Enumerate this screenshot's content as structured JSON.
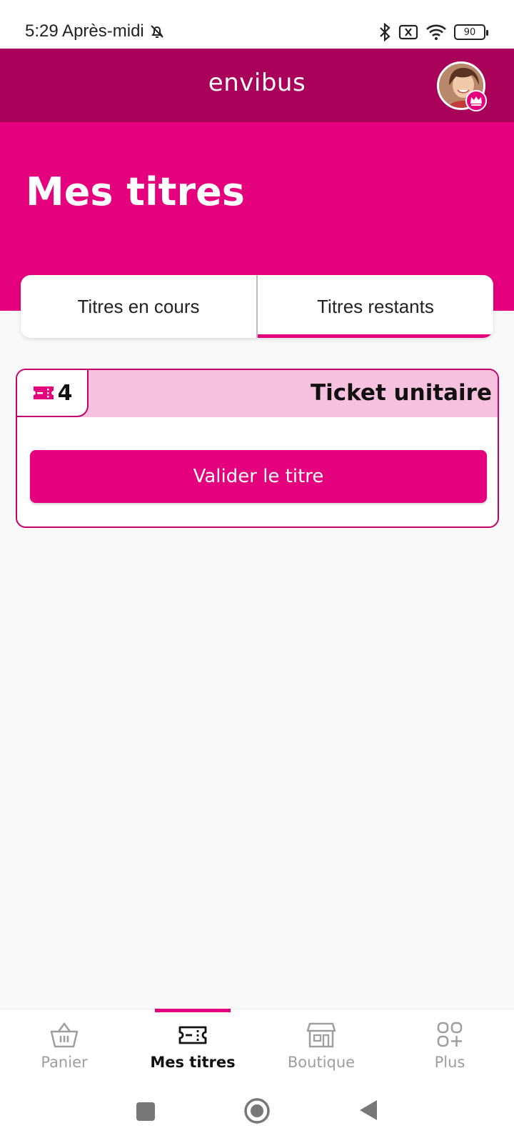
{
  "status_bar": {
    "time": "5:29 Après-midi",
    "battery": "90",
    "icons": [
      "bell-off-icon",
      "bluetooth-icon",
      "sim-off-icon",
      "wifi-icon",
      "battery-icon"
    ]
  },
  "header": {
    "logo": "envibus",
    "avatar_badge_icon": "crown-icon"
  },
  "page": {
    "title": "Mes titres"
  },
  "tabs": [
    {
      "label": "Titres en cours",
      "active": false
    },
    {
      "label": "Titres restants",
      "active": true
    }
  ],
  "ticket": {
    "count": "4",
    "name": "Ticket unitaire",
    "button": "Valider le titre",
    "icon": "ticket-icon"
  },
  "bottom_nav": [
    {
      "label": "Panier",
      "icon": "basket-icon",
      "active": false
    },
    {
      "label": "Mes titres",
      "icon": "ticket-icon",
      "active": true
    },
    {
      "label": "Boutique",
      "icon": "shop-icon",
      "active": false
    },
    {
      "label": "Plus",
      "icon": "grid-plus-icon",
      "active": false
    }
  ],
  "colors": {
    "brand": "#e5007d",
    "brand_dark": "#a9005a",
    "ticket_header": "#f6c1de"
  }
}
